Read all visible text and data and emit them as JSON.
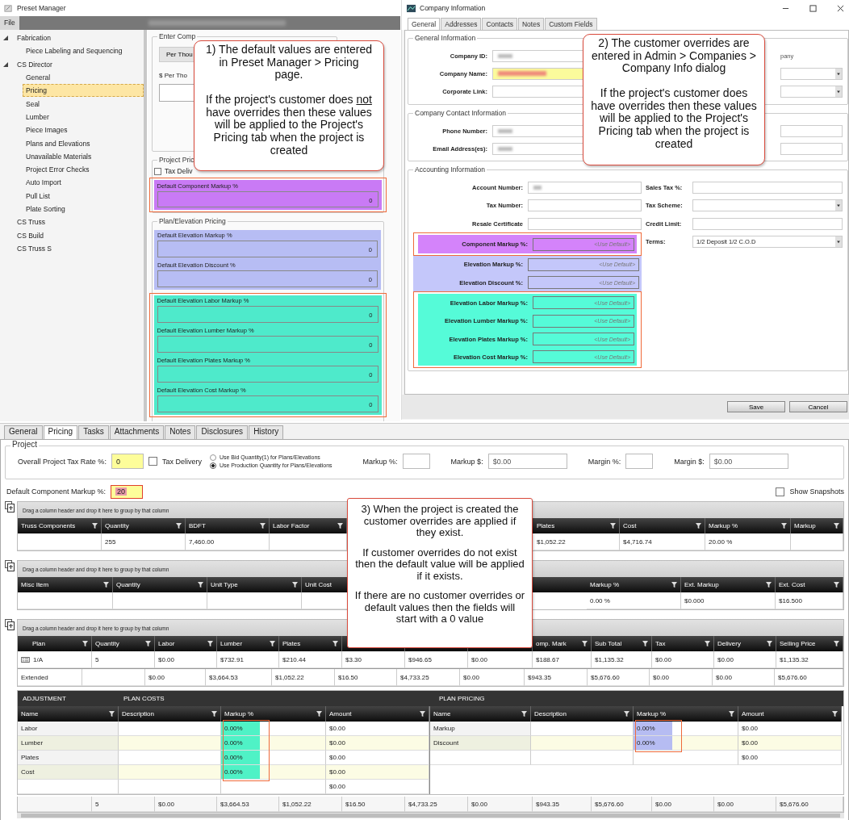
{
  "preset_manager": {
    "title": "Preset Manager",
    "menu": [
      "File"
    ],
    "tree": [
      {
        "label": "Fabrication",
        "expanded": true,
        "selected": false,
        "children": [
          {
            "label": "Piece Labeling and Sequencing",
            "selected": false
          }
        ]
      },
      {
        "label": "CS Director",
        "expanded": true,
        "selected": false,
        "children": [
          {
            "label": "General",
            "selected": false
          },
          {
            "label": "Pricing",
            "selected": true
          },
          {
            "label": "Seal",
            "selected": false
          },
          {
            "label": "Lumber",
            "selected": false
          },
          {
            "label": "Piece Images",
            "selected": false
          },
          {
            "label": "Plans and Elevations",
            "selected": false
          },
          {
            "label": "Unavailable Materials",
            "selected": false
          },
          {
            "label": "Project Error Checks",
            "selected": false
          },
          {
            "label": "Auto Import",
            "selected": false
          },
          {
            "label": "Pull List",
            "selected": false
          },
          {
            "label": "Plate Sorting",
            "selected": false
          }
        ]
      },
      {
        "label": "CS Truss",
        "selected": false
      },
      {
        "label": "CS Build",
        "selected": false
      },
      {
        "label": "CS Truss S",
        "selected": false
      }
    ],
    "labor_group": {
      "title": "Enter Comp",
      "button": "Per Thou",
      "field_label": "$ Per Tho"
    },
    "project_pricing": {
      "title": "Project Pric",
      "checkbox": {
        "label": "Tax Deliv",
        "checked": false
      },
      "groups": [
        {
          "framed": true,
          "fields": [
            {
              "label": "Default Component Markup %",
              "value": "0",
              "color": "#c97af5"
            }
          ]
        }
      ]
    },
    "plan_pricing": {
      "title": "Plan/Elevation Pricing",
      "groups": [
        {
          "fields": [
            {
              "label": "Default Elevation Markup %",
              "value": "0",
              "color": "#b7bdf4"
            },
            {
              "label": "Default Elevation Discount %",
              "value": "0",
              "color": "#b7bdf4"
            }
          ]
        },
        {
          "framed": true,
          "fields": [
            {
              "label": "Default Elevation Labor Markup %",
              "value": "0",
              "color": "#4eeacb"
            },
            {
              "label": "Default Elevation Lumber Markup %",
              "value": "0",
              "color": "#4eeacb"
            },
            {
              "label": "Default Elevation Plates Markup %",
              "value": "0",
              "color": "#4eeacb"
            },
            {
              "label": "Default Elevation Cost Markup %",
              "value": "0",
              "color": "#4eeacb"
            }
          ]
        }
      ]
    }
  },
  "company_info": {
    "title": "Company Information",
    "tabs": [
      {
        "label": "General",
        "selected": true
      },
      {
        "label": "Addresses",
        "selected": false
      },
      {
        "label": "Contacts",
        "selected": false
      },
      {
        "label": "Notes",
        "selected": false
      },
      {
        "label": "Custom Fields",
        "selected": false
      }
    ],
    "general": {
      "title": "General Information",
      "fields": [
        {
          "label": "Company ID:",
          "kind": "blurred"
        },
        {
          "label": "Company Name:",
          "kind": "highlighted"
        },
        {
          "label": "Corporate Link:",
          "kind": "input"
        }
      ],
      "right": [
        {
          "kind": "text",
          "text": "pany"
        },
        {
          "kind": "dropdown"
        },
        {
          "kind": "dropdown"
        }
      ]
    },
    "contact": {
      "title": "Company Contact Information",
      "fields": [
        {
          "label": "Phone Number:",
          "kind": "blurred"
        },
        {
          "label": "Email Address(es):",
          "kind": "blurred"
        }
      ],
      "right": [
        {
          "kind": "input"
        },
        {
          "kind": "input"
        }
      ]
    },
    "accounting": {
      "title": "Accounting Information",
      "fields": [
        {
          "label": "Account Number:",
          "kind": "blurred"
        },
        {
          "label": "Tax Number:",
          "kind": "input"
        },
        {
          "label": "Resale Certificate",
          "kind": "input"
        }
      ],
      "markup_groups": [
        {
          "framed": true,
          "fields": [
            {
              "label": "Component Markup %:",
              "placeholder": "<Use Default>",
              "color": "#d483fa"
            }
          ]
        },
        {
          "fields": [
            {
              "label": "Elevation Markup %:",
              "placeholder": "<Use Default>",
              "color": "#c4c7fa"
            },
            {
              "label": "Elevation Discount %:",
              "placeholder": "<Use Default>",
              "color": "#c4c7fa"
            }
          ]
        },
        {
          "framed": true,
          "fields": [
            {
              "label": "Elevation Labor Markup %:",
              "placeholder": "<Use Default>",
              "color": "#55fbd8"
            },
            {
              "label": "Elevation Lumber Markup %:",
              "placeholder": "<Use Default>",
              "color": "#55fbd8"
            },
            {
              "label": "Elevation Plates Markup %:",
              "placeholder": "<Use Default>",
              "color": "#55fbd8"
            },
            {
              "label": "Elevation Cost Markup %:",
              "placeholder": "<Use Default>",
              "color": "#55fbd8"
            }
          ]
        }
      ],
      "right": [
        {
          "label": "Sales Tax %:",
          "kind": "input"
        },
        {
          "label": "Tax Scheme:",
          "kind": "dropdown"
        },
        {
          "label": "Credit Limit:",
          "kind": "input"
        },
        {
          "label": "Terms:",
          "kind": "dropdown",
          "value": "1/2 Deposit 1/2 C.O.D"
        }
      ]
    },
    "buttons": [
      "Save",
      "Cancel"
    ]
  },
  "project_pricing": {
    "tabs": [
      {
        "label": "General",
        "selected": false
      },
      {
        "label": "Pricing",
        "selected": true
      },
      {
        "label": "Tasks",
        "selected": false
      },
      {
        "label": "Attachments",
        "selected": false
      },
      {
        "label": "Notes",
        "selected": false
      },
      {
        "label": "Disclosures",
        "selected": false
      },
      {
        "label": "History",
        "selected": false
      }
    ],
    "group_title": "Project",
    "tax_rate": {
      "label": "Overall Project Tax Rate %:",
      "value": "0"
    },
    "tax_delivery": {
      "label": "Tax Delivery",
      "checked": false
    },
    "quantity_options": [
      {
        "label": "Use Bid Quantity(1) for Plans/Elevations",
        "selected": false
      },
      {
        "label": "Use Production Quantity for Plans/Elevations",
        "selected": true
      }
    ],
    "summary_fields": [
      {
        "label": "Markup %:"
      },
      {
        "label": "Markup $:",
        "value": "$0.00"
      },
      {
        "label": "Margin %:"
      },
      {
        "label": "Margin $:",
        "value": "$0.00"
      }
    ],
    "default_markup": {
      "label": "Default Component Markup %:",
      "value": "20"
    },
    "show_snapshots": {
      "label": "Show Snapshots",
      "checked": false
    },
    "grids": [
      {
        "kind": "truss",
        "group_hint": "Drag a column header and drop it here to group by that column",
        "columns": [
          {
            "label": "Truss Components"
          },
          {
            "label": "Quantity",
            "cells": [
              "255"
            ]
          },
          {
            "label": "BDFT",
            "cells": [
              "7,460.00"
            ]
          },
          {
            "label": "Labor Factor"
          },
          {
            "label": "Plates",
            "cells": [
              "$1,052.22"
            ]
          },
          {
            "label": "Cost",
            "cells": [
              "$4,716.74"
            ]
          },
          {
            "label": "Markup %",
            "cells": [
              "20.00 %"
            ]
          },
          {
            "label": "Markup"
          }
        ]
      },
      {
        "kind": "misc",
        "group_hint": "Drag a column header and drop it here to group by that column",
        "columns": [
          {
            "label": "Misc Item"
          },
          {
            "label": "Quantity"
          },
          {
            "label": "Unit Type"
          },
          {
            "label": "Unit Cost"
          },
          {
            "label": "Markup %",
            "cells": [
              "0.00 %"
            ]
          },
          {
            "label": "Ext. Markup",
            "cells": [
              "$0.000"
            ]
          },
          {
            "label": "Ext. Cost",
            "cells": [
              "$16.500"
            ]
          }
        ]
      },
      {
        "kind": "plan",
        "group_hint": "Drag a column header and drop it here to group by that column",
        "columns": [
          {
            "label": "Plan",
            "cells": [
              "1/A"
            ]
          },
          {
            "label": "Quantity",
            "cells": [
              "5"
            ]
          },
          {
            "label": "Labor",
            "cells": [
              "$0.00"
            ]
          },
          {
            "label": "Lumber",
            "cells": [
              "$732.91"
            ]
          },
          {
            "label": "Plates",
            "cells": [
              "$210.44"
            ]
          },
          {
            "cells": [
              "$3.30"
            ]
          },
          {
            "cells": [
              "$946.65"
            ]
          },
          {
            "cells": [
              "$0.00"
            ]
          },
          {
            "label": "omp. Mark",
            "cells": [
              "$188.67"
            ]
          },
          {
            "label": "Sub Total",
            "cells": [
              "$1,135.32"
            ]
          },
          {
            "label": "Tax",
            "cells": [
              "$0.00"
            ]
          },
          {
            "label": "Delivery",
            "cells": [
              "$0.00"
            ]
          },
          {
            "label": "Selling Price",
            "cells": [
              "$1,135.32"
            ]
          }
        ],
        "extended_row": [
          "Extended",
          "$0.00",
          "$3,664.53",
          "$1,052.22",
          "$16.50",
          "$4,733.25",
          "$0.00",
          "$943.35",
          "$5,676.60",
          "$0.00",
          "$0.00",
          "$5,676.60"
        ]
      }
    ],
    "adjustment": {
      "titles": [
        "ADJUSTMENT",
        "PLAN COSTS",
        "PLAN PRICING"
      ],
      "costs": {
        "columns": [
          "Name",
          "Description",
          "Markup %",
          "Amount"
        ],
        "framed": true,
        "rows": [
          {
            "name": "Labor",
            "markup": "0.00%",
            "amount": "$0.00",
            "color": "#4ff2c6"
          },
          {
            "name": "Lumber",
            "markup": "0.00%",
            "amount": "$0.00",
            "color": "#4ff2c6"
          },
          {
            "name": "Plates",
            "markup": "0.00%",
            "amount": "$0.00",
            "color": "#4ff2c6"
          },
          {
            "name": "Cost",
            "markup": "0.00%",
            "amount": "$0.00",
            "color": "#4ff2c6"
          }
        ],
        "total": "$0.00"
      },
      "pricing": {
        "columns": [
          "Name",
          "Description",
          "Markup %",
          "Amount"
        ],
        "framed": true,
        "rows": [
          {
            "name": "Markup",
            "markup": "0.00%",
            "amount": "$0.00",
            "color": "#b6bcf2"
          },
          {
            "name": "Discount",
            "markup": "0.00%",
            "amount": "$0.00",
            "color": "#b6bcf2"
          }
        ],
        "total": "$0.00"
      }
    },
    "totals": [
      "5",
      "$0.00",
      "$3,664.53",
      "$1,052.22",
      "$16.50",
      "$4,733.25",
      "$0.00",
      "$943.35",
      "$5,676.60",
      "$0.00",
      "$0.00",
      "$5,676.60"
    ]
  },
  "callouts": [
    {
      "paragraphs": [
        [
          {
            "text": "1) The default values are entered in Preset Manager > Pricing page.",
            "underlined": false
          }
        ],
        [
          {
            "text": "If the project's customer does ",
            "underlined": false
          },
          {
            "text": "not",
            "underlined": true
          },
          {
            "text": " have overrides then these values will be applied to the Project's Pricing tab when the project is created",
            "underlined": false
          }
        ]
      ]
    },
    {
      "paragraphs": [
        [
          {
            "text": "2) The customer overrides are entered in Admin > Companies > Company Info dialog",
            "underlined": false
          }
        ],
        [
          {
            "text": "If the project's customer does have overrides then these values will be applied to the Project's Pricing tab when the project is created",
            "underlined": false
          }
        ]
      ]
    },
    {
      "paragraphs": [
        [
          {
            "text": "3) When the project is created the customer overrides are applied if they exist.",
            "underlined": false
          }
        ],
        [
          {
            "text": "If customer overrides do not exist then the default value will be applied if it exists.",
            "underlined": false
          }
        ],
        [
          {
            "text": "If there are no customer overrides or default values then the fields will start with a 0 value",
            "underlined": false
          }
        ]
      ]
    }
  ]
}
